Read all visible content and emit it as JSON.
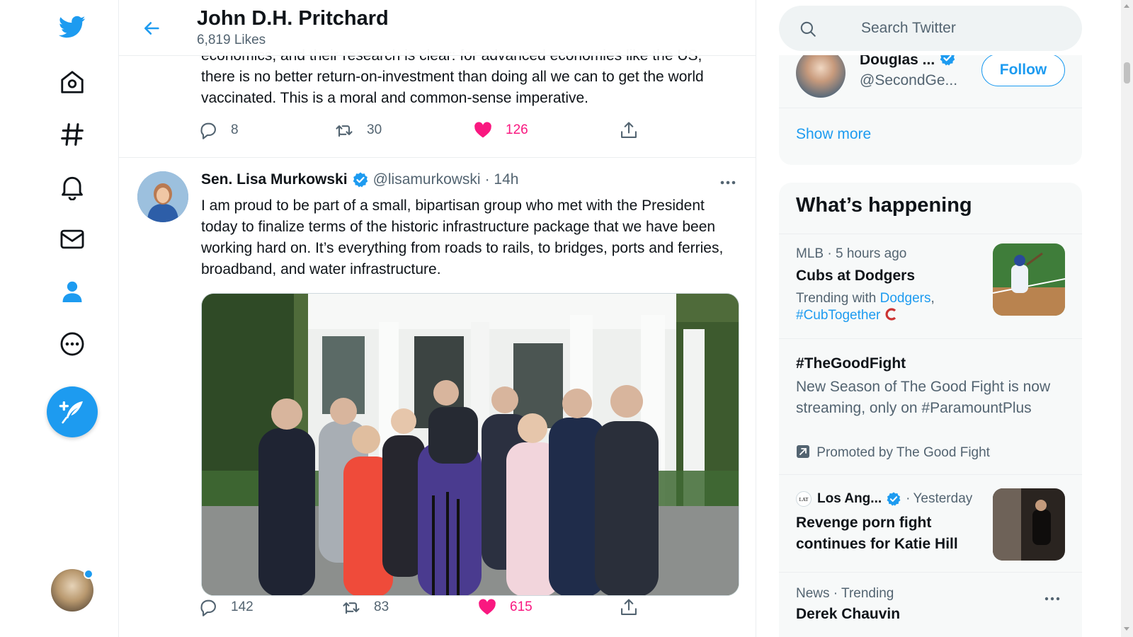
{
  "header": {
    "title": "John D.H. Pritchard",
    "subtitle": "6,819 Likes"
  },
  "nav": {
    "items": [
      "twitter-logo",
      "home-icon",
      "explore-icon",
      "notifications-icon",
      "messages-icon",
      "profile-icon",
      "more-icon"
    ],
    "accent": "#1d9bf0"
  },
  "tweet1": {
    "text_partial": "economics, and their research is clear: for advanced economies like the US,",
    "text": "there is no better return-on-investment than doing all we can to get the world vaccinated. This is a moral and common-sense imperative.",
    "replies": "8",
    "retweets": "30",
    "likes": "126"
  },
  "tweet2": {
    "name": "Sen. Lisa Murkowski",
    "handle": "@lisamurkowski",
    "time": "· 14h",
    "text": "I am proud to be part of a small, bipartisan group who met with the President today to finalize terms of the historic infrastructure package that we have been working hard on. It’s everything from roads to rails, to bridges, ports and ferries, broadband, and water infrastructure.",
    "replies": "142",
    "retweets": "83",
    "likes": "615"
  },
  "search": {
    "placeholder": "Search Twitter"
  },
  "who_to_follow": {
    "name": "Douglas ...",
    "handle": "@SecondGe...",
    "follow_label": "Follow",
    "show_more": "Show more"
  },
  "happening": {
    "title": "What’s happening",
    "trends": [
      {
        "meta_source": "MLB",
        "meta_time": "5 hours ago",
        "title": "Cubs at Dodgers",
        "trending_with": "Trending with",
        "link1": "Dodgers",
        "link2": "#CubTogether"
      },
      {
        "title": "#TheGoodFight",
        "body": "New Season of The Good Fight is now streaming, only on #ParamountPlus",
        "promoted": "Promoted by The Good Fight"
      },
      {
        "meta_source": "Los Ang...",
        "meta_time": "Yesterday",
        "title": "Revenge porn fight continues for Katie Hill"
      },
      {
        "meta": "News · Trending",
        "title": "Derek Chauvin"
      }
    ]
  },
  "colors": {
    "like": "#f91880",
    "secondary_text": "#536471",
    "link": "#1d9bf0"
  }
}
